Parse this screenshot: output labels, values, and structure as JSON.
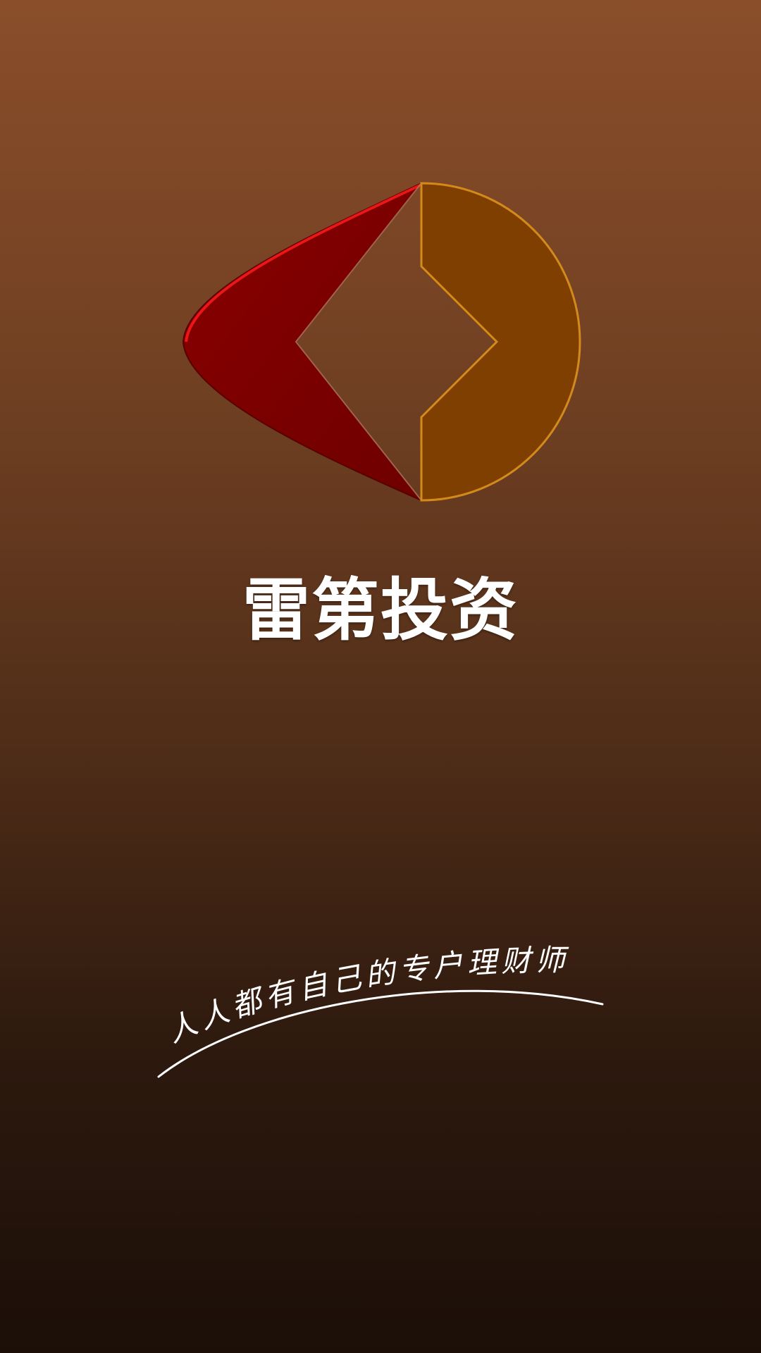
{
  "splash": {
    "brand_name": "雷第投资",
    "slogan": "人人都有自己的专户理财师",
    "logo_icon": "leidi-logo-icon",
    "colors": {
      "background_top": "#8a4e2a",
      "background_bottom": "#1b0f08",
      "logo_red": "#7a0000",
      "logo_red_highlight": "#ff1a1a",
      "logo_orange": "#7f3f00",
      "logo_orange_edge": "#d38a1a",
      "text": "#ffffff"
    }
  }
}
